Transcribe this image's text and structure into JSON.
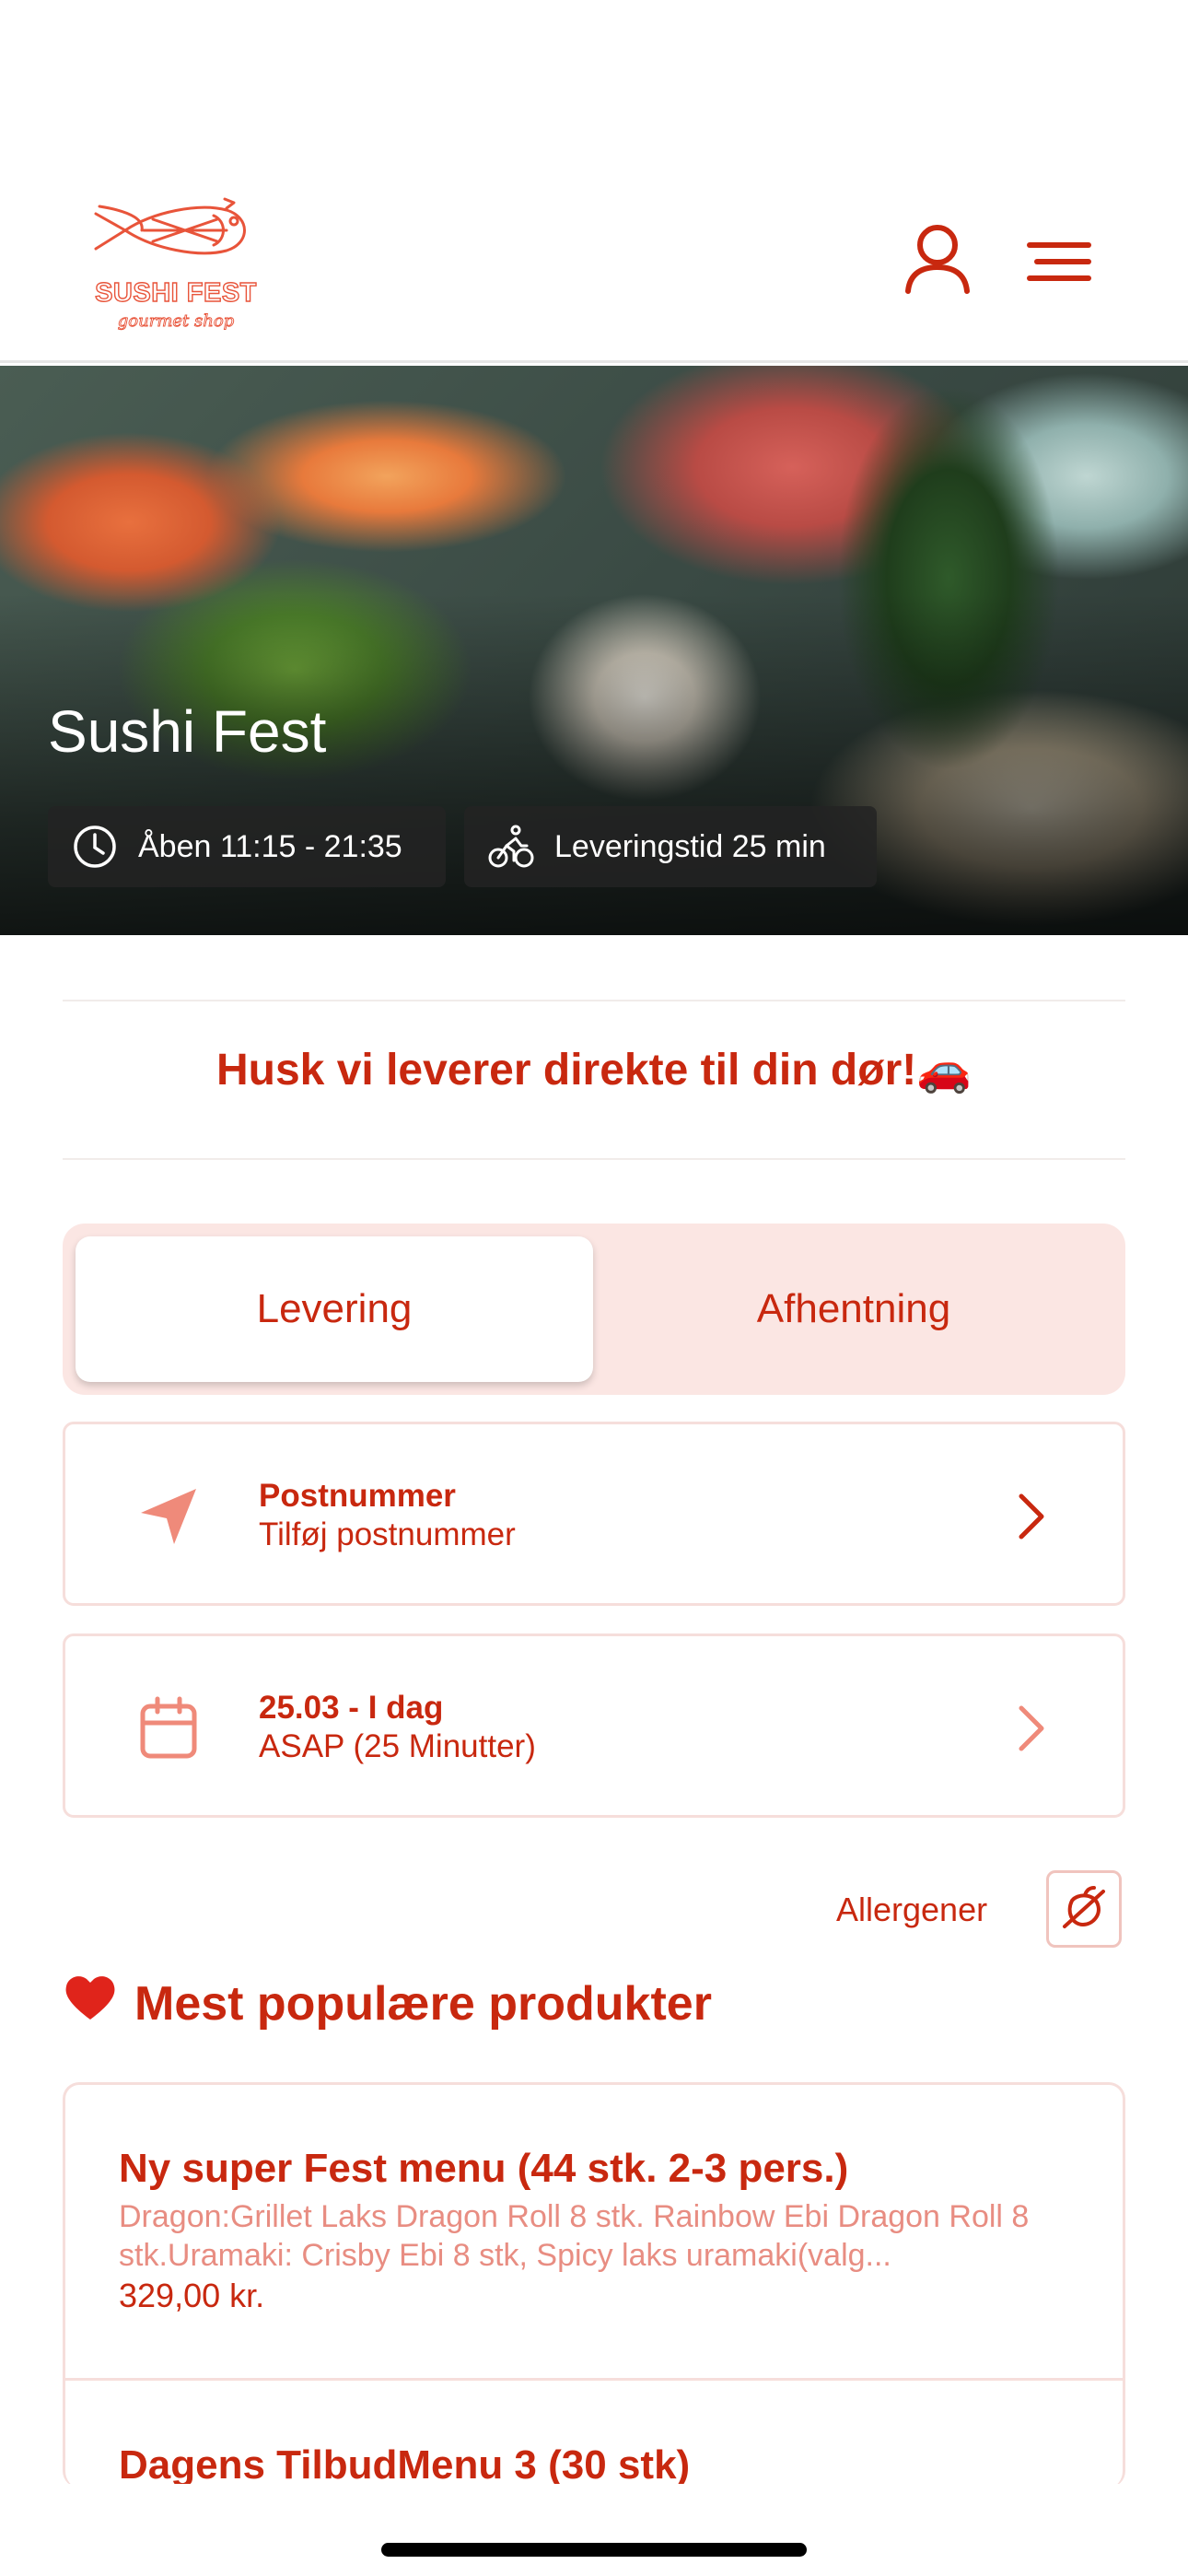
{
  "brand": {
    "logo_title": "SUSHI FEST",
    "logo_subtitle": "gourmet shop",
    "accent_color": "#c8280f",
    "light_accent": "#fbe6e3"
  },
  "header": {
    "account_icon": "user-icon",
    "menu_icon": "hamburger-menu-icon"
  },
  "hero": {
    "title": "Sushi Fest",
    "opening_hours": "Åben 11:15 - 21:35",
    "delivery_time": "Leveringstid 25 min"
  },
  "notice": "Husk vi leverer direkte til din dør!🚗",
  "order_mode": {
    "options": [
      "Levering",
      "Afhentning"
    ],
    "selected": "Levering"
  },
  "postcode_card": {
    "title": "Postnummer",
    "subtitle": "Tilføj postnummer"
  },
  "time_card": {
    "title": "25.03 - I dag",
    "subtitle": "ASAP (25 Minutter)"
  },
  "allergens": {
    "label": "Allergener"
  },
  "popular": {
    "title": "Mest populære produkter",
    "emoji": "❤️",
    "products": [
      {
        "name": "Ny super Fest menu (44 stk. 2-3 pers.)",
        "description": "Dragon:Grillet Laks Dragon Roll 8 stk. Rainbow Ebi Dragon Roll 8 stk.Uramaki: Crisby Ebi 8 stk, Spicy laks uramaki(valg...",
        "price": "329,00 kr."
      },
      {
        "name": "Dagens TilbudMenu 3 (30 stk)"
      }
    ]
  }
}
